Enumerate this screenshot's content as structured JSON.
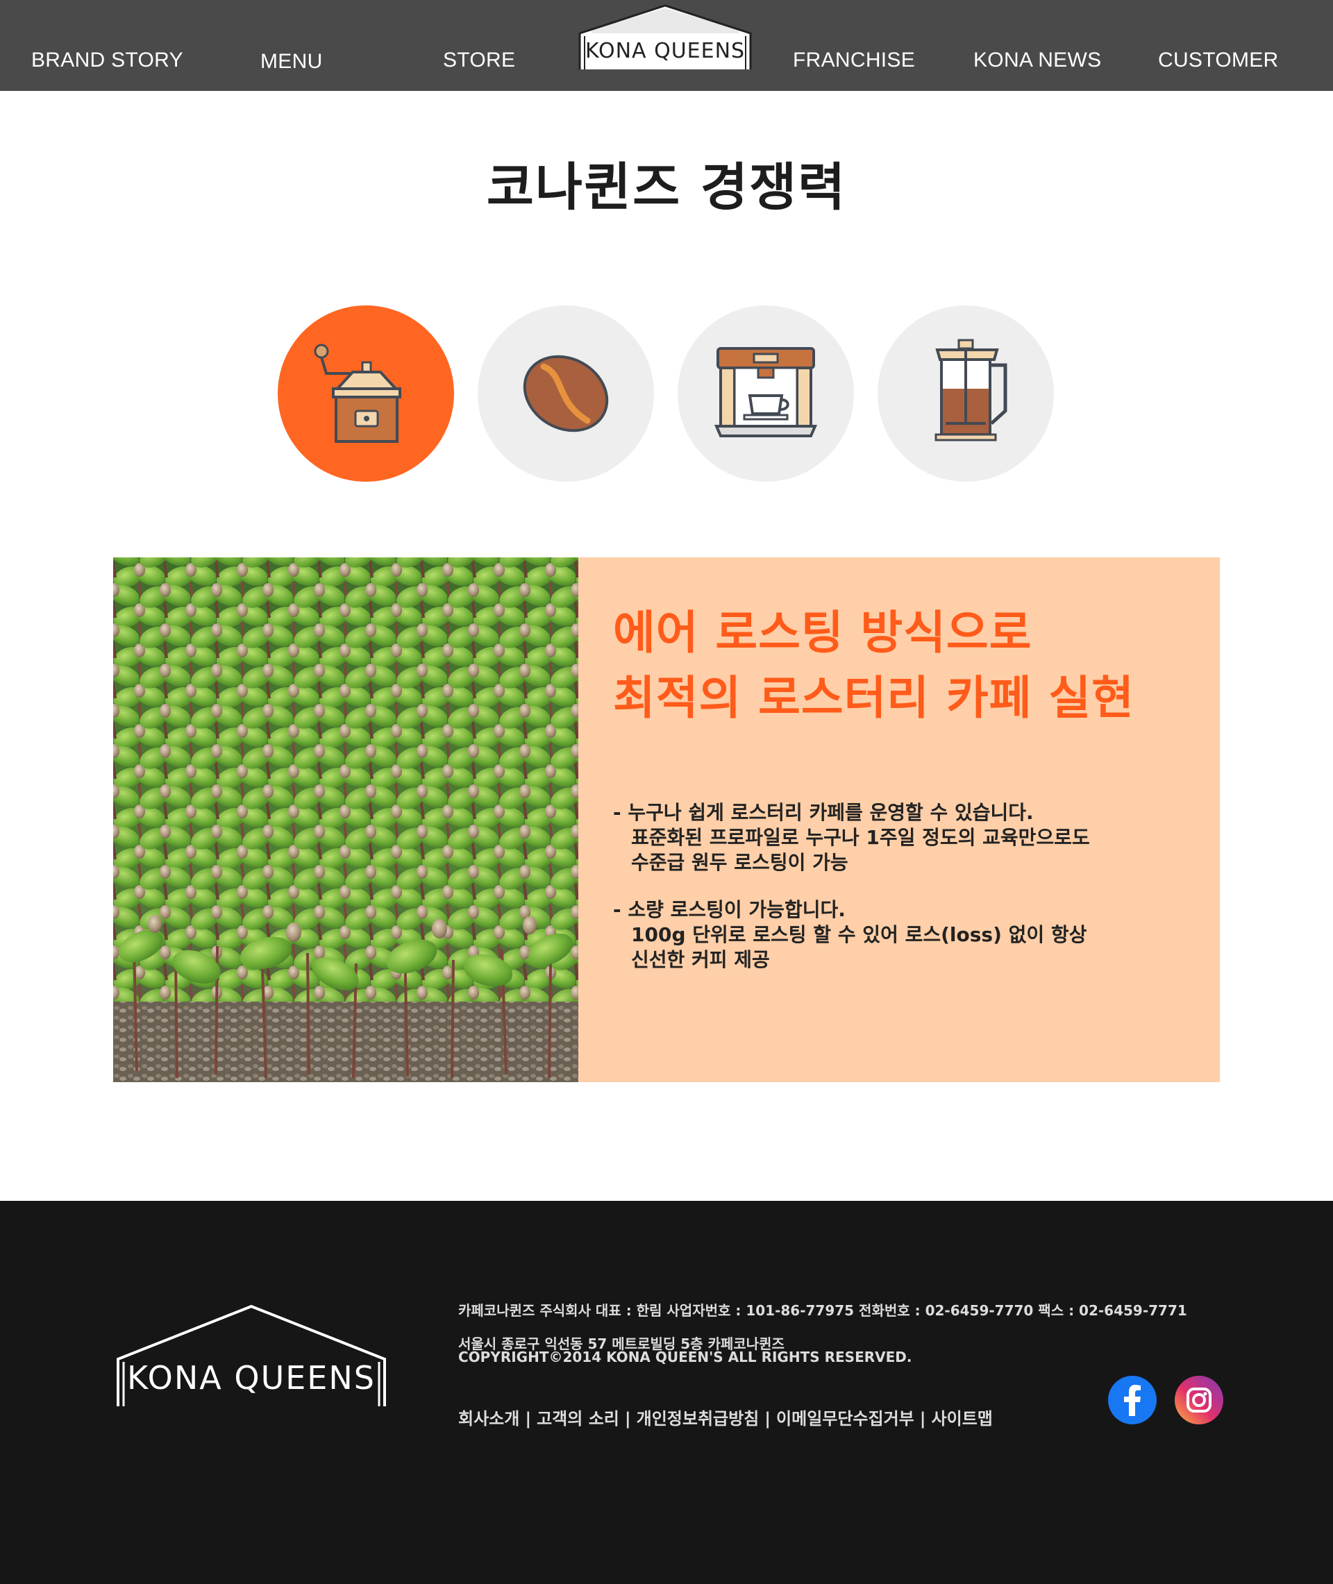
{
  "nav": {
    "items": [
      "BRAND STORY",
      "MENU",
      "STORE",
      "FRANCHISE",
      "KONA NEWS",
      "CUSTOMER"
    ],
    "logo_text": "KONA QUEENS"
  },
  "page_title": "코나퀸즈 경쟁력",
  "icons": [
    {
      "name": "coffee-grinder-icon",
      "active": true
    },
    {
      "name": "coffee-bean-icon",
      "active": false
    },
    {
      "name": "espresso-machine-icon",
      "active": false
    },
    {
      "name": "french-press-icon",
      "active": false
    }
  ],
  "feature": {
    "headline_line1": "에어 로스팅 방식으로",
    "headline_line2": "최적의 로스터리 카페 실현",
    "bullets": [
      {
        "head": "- 누구나 쉽게 로스터리 카페를 운영할 수 있습니다.",
        "line1": "표준화된 프로파일로 누구나 1주일 정도의 교육만으로도",
        "line2": "수준급 원두 로스팅이 가능"
      },
      {
        "head": "- 소량 로스팅이 가능합니다.",
        "line1": "100g 단위로 로스팅 할 수 있어 로스(loss) 없이 항상",
        "line2": "신선한 커피 제공"
      }
    ]
  },
  "footer": {
    "logo_text": "KONA QUEENS",
    "company_line": "카페코나퀸즈 주식회사   대표 : 한림   사업자번호 : 101-86-77975  전화번호 : 02-6459-7770   팩스 : 02-6459-7771",
    "address_line": "서울시 종로구 익선동 57 메트로빌딩 5층 카페코나퀸즈",
    "copyright_line": "COPYRIGHT©2014 KONA QUEEN'S ALL RIGHTS RESERVED.",
    "links": [
      "회사소개",
      "고객의 소리",
      "개인정보취급방침",
      "이메일무단수집거부",
      "사이트맵"
    ],
    "link_separator": "|",
    "social": [
      "facebook-icon",
      "instagram-icon"
    ]
  },
  "colors": {
    "nav_bg": "#4a4a4a",
    "accent_orange": "#ff6622",
    "headline_orange": "#ff5b1a",
    "panel_peach": "#fecfa8",
    "footer_bg": "#161616",
    "circle_gray": "#eeeeee"
  }
}
